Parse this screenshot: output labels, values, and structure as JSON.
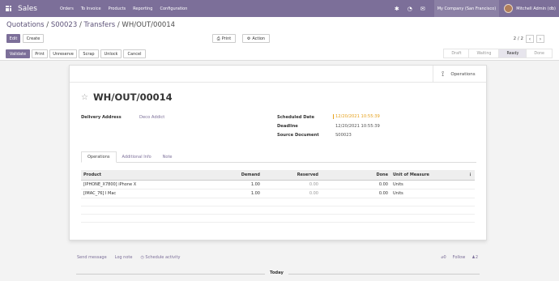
{
  "navbar": {
    "app": "Sales",
    "menu": [
      "Orders",
      "To Invoice",
      "Products",
      "Reporting",
      "Configuration"
    ],
    "company": "My Company (San Francisco)",
    "user": "Mitchell Admin (db)"
  },
  "breadcrumb": {
    "parts": [
      "Quotations",
      "S00023",
      "Transfers"
    ],
    "separator": "/",
    "current": "WH/OUT/00014"
  },
  "actions": {
    "edit": "Edit",
    "create": "Create",
    "print": "Print",
    "action": "Action"
  },
  "pager": {
    "value": "2 / 2",
    "prev": "‹",
    "next": "›"
  },
  "workflow": {
    "validate": "Validate",
    "print": "Print",
    "unreserve": "Unreserve",
    "scrap": "Scrap",
    "unlock": "Unlock",
    "cancel": "Cancel"
  },
  "stages": [
    {
      "label": "Draft",
      "active": false
    },
    {
      "label": "Waiting",
      "active": false
    },
    {
      "label": "Ready",
      "active": true
    },
    {
      "label": "Done",
      "active": false
    }
  ],
  "smart_button": {
    "label": "Operations",
    "icon": "operations-icon"
  },
  "record": {
    "name": "WH/OUT/00014",
    "delivery_address_label": "Delivery Address",
    "delivery_address": "Deco Addict",
    "scheduled_date_label": "Scheduled Date",
    "scheduled_date": "12/20/2021 10:55:39",
    "deadline_label": "Deadline",
    "deadline": "12/20/2021 10:55:39",
    "source_label": "Source Document",
    "source": "S00023"
  },
  "tabs": [
    "Operations",
    "Additional Info",
    "Note"
  ],
  "table": {
    "headers": [
      "Product",
      "Demand",
      "Reserved",
      "Done",
      "Unit of Measure"
    ],
    "rows": [
      {
        "product": "[IPHONE_X7800] iPhone X",
        "demand": "1.00",
        "reserved": "0.00",
        "done": "0.00",
        "uom": "Units"
      },
      {
        "product": "[IMAC_76] I Mac",
        "demand": "1.00",
        "reserved": "0.00",
        "done": "0.00",
        "uom": "Units"
      }
    ]
  },
  "chatter": {
    "send_message": "Send message",
    "log_note": "Log note",
    "schedule": "Schedule activity",
    "attachments": "0",
    "follow": "Follow",
    "followers": "2",
    "today": "Today"
  },
  "colors": {
    "primary": "#7c6f99",
    "warning": "#e6a11c"
  }
}
